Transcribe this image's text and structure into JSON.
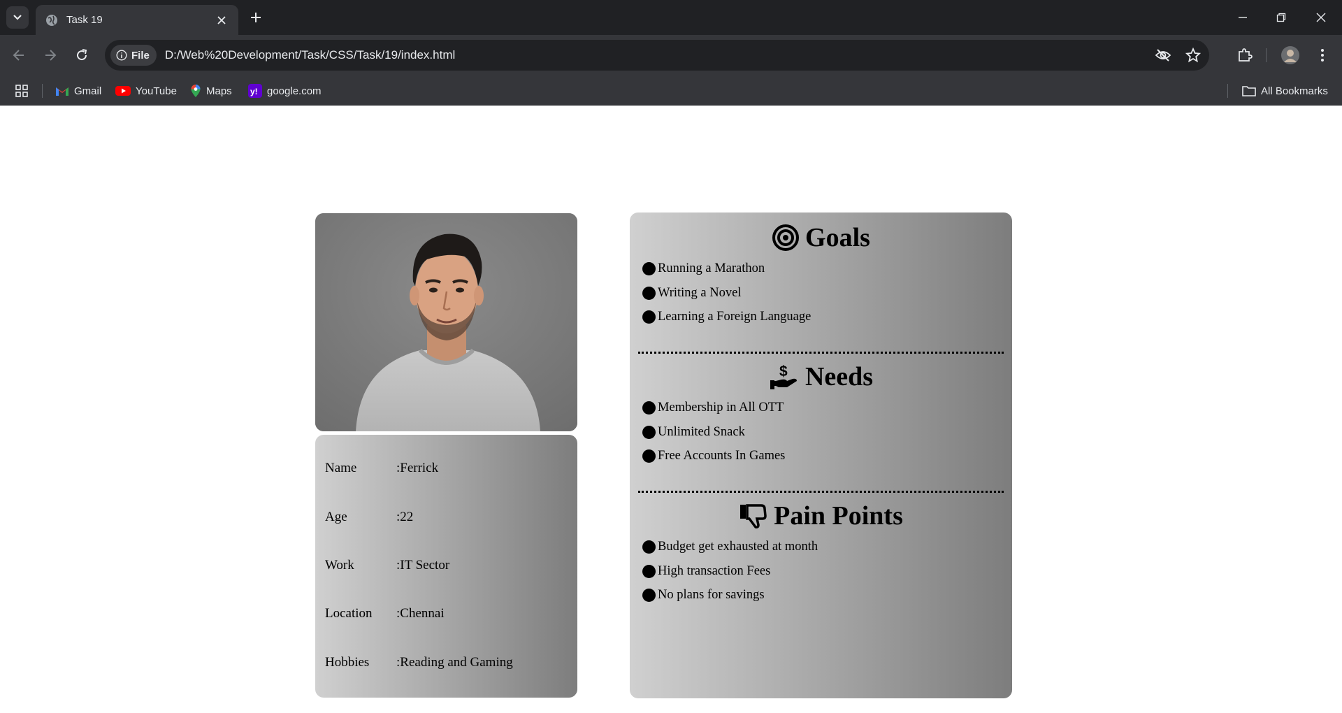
{
  "browser": {
    "tab_title": "Task 19",
    "file_chip": "File",
    "url": "D:/Web%20Development/Task/CSS/Task/19/index.html",
    "bookmarks": [
      {
        "label": "Gmail",
        "icon": "gmail-icon"
      },
      {
        "label": "YouTube",
        "icon": "youtube-icon"
      },
      {
        "label": "Maps",
        "icon": "maps-icon"
      },
      {
        "label": "google.com",
        "icon": "yahoo-icon"
      }
    ],
    "all_bookmarks": "All Bookmarks"
  },
  "profile": {
    "photo": "portrait-photo",
    "fields": [
      {
        "key": "Name",
        "value": ":Ferrick"
      },
      {
        "key": "Age",
        "value": ":22"
      },
      {
        "key": "Work",
        "value": ":IT Sector"
      },
      {
        "key": "Location",
        "value": ":Chennai"
      },
      {
        "key": "Hobbies",
        "value": ":Reading and Gaming"
      }
    ]
  },
  "sections": {
    "goals": {
      "title": "Goals",
      "icon": "target-icon",
      "items": [
        "Running a Marathon",
        "Writing a Novel",
        "Learning a Foreign Language"
      ]
    },
    "needs": {
      "title": "Needs",
      "icon": "hand-money-icon",
      "items": [
        "Membership in All OTT",
        "Unlimited Snack",
        "Free Accounts In Games"
      ]
    },
    "pain_points": {
      "title": "Pain Points",
      "icon": "thumbs-down-icon",
      "items": [
        "Budget get exhausted at month",
        "High transaction Fees",
        "No plans for savings"
      ]
    }
  },
  "colors": {
    "card_gradient_start": "#d0d0d0",
    "card_gradient_end": "#7d7d7d",
    "chrome_dark": "#202124",
    "chrome_mid": "#35363a"
  }
}
